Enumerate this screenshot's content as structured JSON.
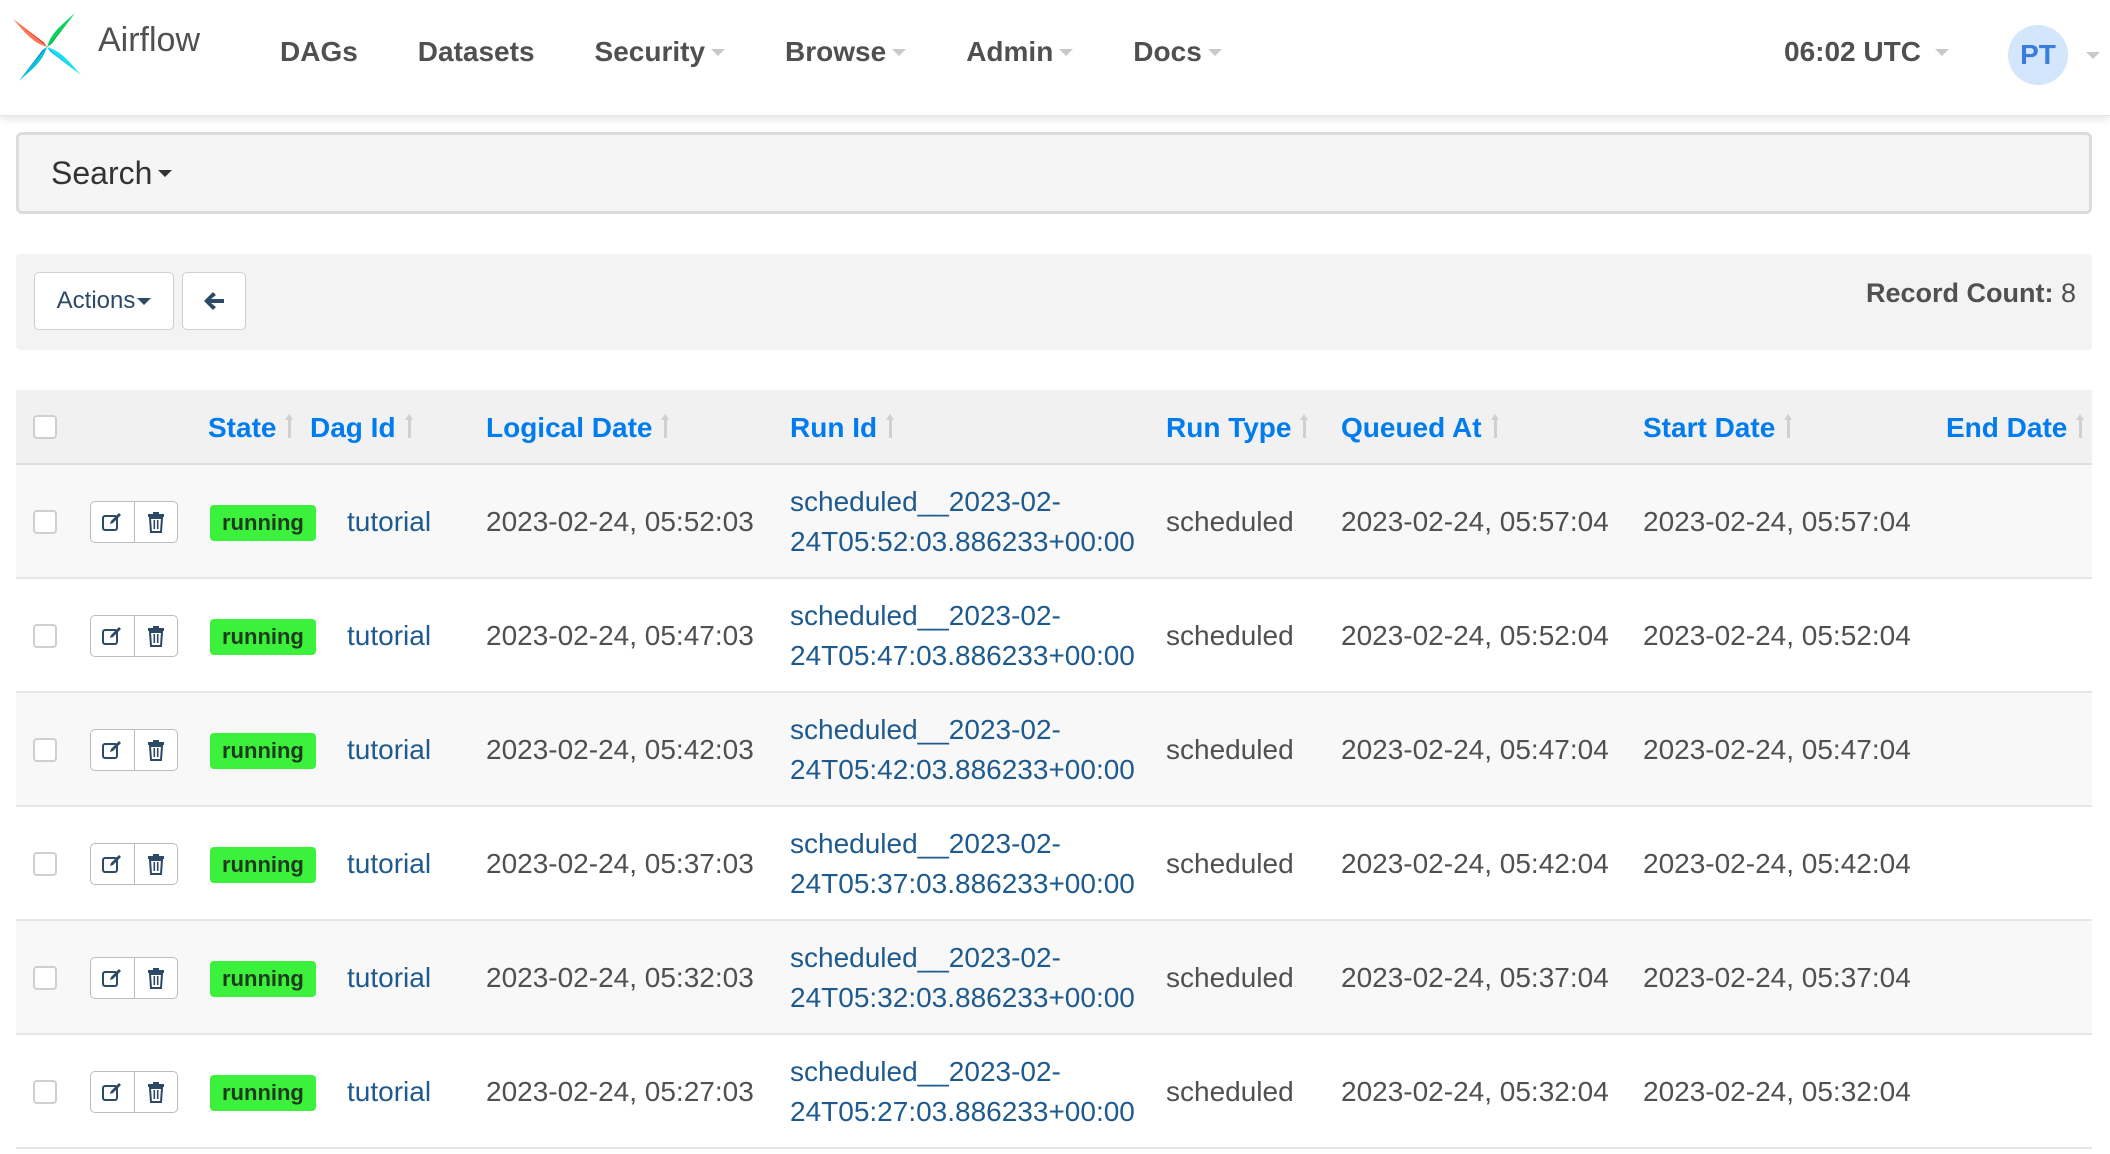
{
  "navbar": {
    "brand": "Airflow",
    "menu": [
      {
        "label": "DAGs",
        "dropdown": false
      },
      {
        "label": "Datasets",
        "dropdown": false
      },
      {
        "label": "Security",
        "dropdown": true
      },
      {
        "label": "Browse",
        "dropdown": true
      },
      {
        "label": "Admin",
        "dropdown": true
      },
      {
        "label": "Docs",
        "dropdown": true
      }
    ],
    "clock": "06:02 UTC",
    "user_initials": "PT"
  },
  "search": {
    "label": "Search"
  },
  "actions_bar": {
    "actions_label": "Actions",
    "record_count_label": "Record Count:",
    "record_count": "8"
  },
  "table": {
    "columns": [
      "State",
      "Dag Id",
      "Logical Date",
      "Run Id",
      "Run Type",
      "Queued At",
      "Start Date",
      "End Date"
    ],
    "rows": [
      {
        "state": "running",
        "dag_id": "tutorial",
        "logical_date": "2023-02-24, 05:52:03",
        "run_id_line1": "scheduled__2023-02-",
        "run_id_line2": "24T05:52:03.886233+00:00",
        "run_type": "scheduled",
        "queued_at": "2023-02-24, 05:57:04",
        "start_date": "2023-02-24, 05:57:04",
        "end_date": ""
      },
      {
        "state": "running",
        "dag_id": "tutorial",
        "logical_date": "2023-02-24, 05:47:03",
        "run_id_line1": "scheduled__2023-02-",
        "run_id_line2": "24T05:47:03.886233+00:00",
        "run_type": "scheduled",
        "queued_at": "2023-02-24, 05:52:04",
        "start_date": "2023-02-24, 05:52:04",
        "end_date": ""
      },
      {
        "state": "running",
        "dag_id": "tutorial",
        "logical_date": "2023-02-24, 05:42:03",
        "run_id_line1": "scheduled__2023-02-",
        "run_id_line2": "24T05:42:03.886233+00:00",
        "run_type": "scheduled",
        "queued_at": "2023-02-24, 05:47:04",
        "start_date": "2023-02-24, 05:47:04",
        "end_date": ""
      },
      {
        "state": "running",
        "dag_id": "tutorial",
        "logical_date": "2023-02-24, 05:37:03",
        "run_id_line1": "scheduled__2023-02-",
        "run_id_line2": "24T05:37:03.886233+00:00",
        "run_type": "scheduled",
        "queued_at": "2023-02-24, 05:42:04",
        "start_date": "2023-02-24, 05:42:04",
        "end_date": ""
      },
      {
        "state": "running",
        "dag_id": "tutorial",
        "logical_date": "2023-02-24, 05:32:03",
        "run_id_line1": "scheduled__2023-02-",
        "run_id_line2": "24T05:32:03.886233+00:00",
        "run_type": "scheduled",
        "queued_at": "2023-02-24, 05:37:04",
        "start_date": "2023-02-24, 05:37:04",
        "end_date": ""
      },
      {
        "state": "running",
        "dag_id": "tutorial",
        "logical_date": "2023-02-24, 05:27:03",
        "run_id_line1": "scheduled__2023-02-",
        "run_id_line2": "24T05:27:03.886233+00:00",
        "run_type": "scheduled",
        "queued_at": "2023-02-24, 05:32:04",
        "start_date": "2023-02-24, 05:32:04",
        "end_date": ""
      }
    ]
  },
  "icons": {
    "logo": "airflow-pinwheel-icon",
    "back": "arrow-left-icon",
    "edit": "edit-icon",
    "delete": "trash-icon",
    "sort": "sort-icon"
  },
  "colors": {
    "link": "#017cee",
    "running_badge": "#3cf13c",
    "run_link": "#1f5a8e"
  }
}
